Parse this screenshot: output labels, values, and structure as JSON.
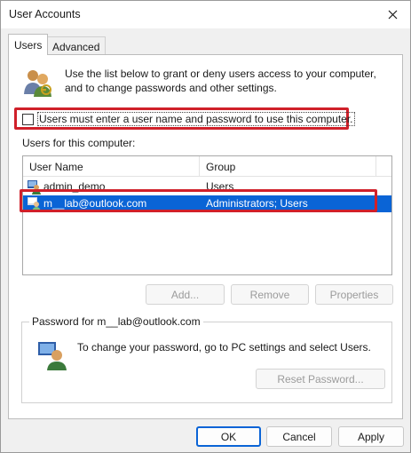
{
  "window": {
    "title": "User Accounts"
  },
  "tabs": [
    {
      "label": "Users",
      "active": true
    },
    {
      "label": "Advanced",
      "active": false
    }
  ],
  "intro": {
    "line1": "Use the list below to grant or deny users access to your computer,",
    "line2": "and to change passwords and other settings."
  },
  "require_login": {
    "label": "Users must enter a user name and password to use this computer.",
    "checked": false
  },
  "users_section": {
    "label": "Users for this computer:",
    "columns": [
      "User Name",
      "Group"
    ],
    "rows": [
      {
        "name": "admin_demo",
        "group": "Users",
        "selected": false
      },
      {
        "name": "m__lab@outlook.com",
        "group": "Administrators; Users",
        "selected": true
      }
    ]
  },
  "list_buttons": {
    "add": "Add...",
    "remove": "Remove",
    "properties": "Properties"
  },
  "password_group": {
    "title": "Password for m__lab@outlook.com",
    "text": "To change your password, go to PC settings and select Users.",
    "reset_button": "Reset Password..."
  },
  "footer": {
    "ok": "OK",
    "cancel": "Cancel",
    "apply": "Apply"
  },
  "colors": {
    "selection": "#0a64d6",
    "highlight": "#d0202a"
  },
  "icons": {
    "users": "users-icon",
    "user_row": "user-icon",
    "password": "password-user-icon",
    "close": "close-icon"
  }
}
